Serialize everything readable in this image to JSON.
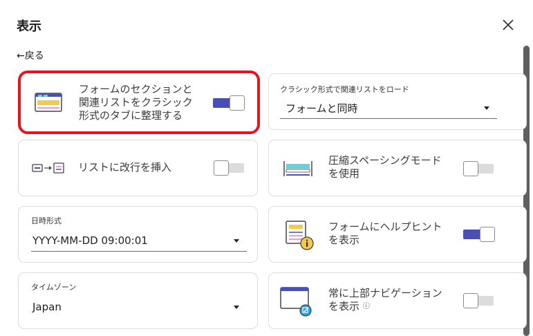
{
  "dialog": {
    "title": "表示",
    "back_label": "←戻る"
  },
  "settings": {
    "form_sections_tabs": {
      "label_lines": [
        "フォームのセクションと",
        "関連リストをクラシック",
        "形式のタブに整理する"
      ],
      "enabled": true
    },
    "related_list_load": {
      "label": "クラシック形式で関連リストをロード",
      "value": "フォームと同時"
    },
    "list_line_break": {
      "label": "リストに改行を挿入",
      "enabled": false
    },
    "compact_spacing": {
      "label_lines": [
        "圧縮スペーシングモード",
        "を使用"
      ],
      "enabled": false
    },
    "datetime_format": {
      "label": "日時形式",
      "value": "YYYY-MM-DD 09:00:01"
    },
    "form_help_hints": {
      "label_lines": [
        "フォームにヘルプヒント",
        "を表示"
      ],
      "enabled": true
    },
    "timezone": {
      "label": "タイムゾーン",
      "value": "Japan"
    },
    "top_navigation": {
      "label_lines": [
        "常に上部ナビゲーション",
        "を表示"
      ],
      "info_glyph": "ⓘ",
      "enabled": false
    }
  },
  "colors": {
    "accent": "#4a4fb5",
    "highlight": "#e8141b",
    "toggle_off": "#dcdcdc"
  }
}
